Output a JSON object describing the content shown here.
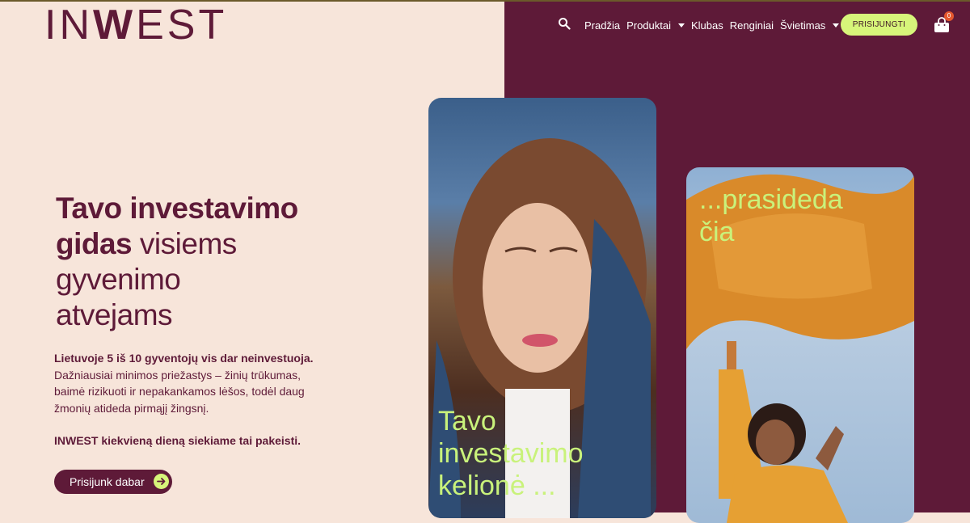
{
  "brand": {
    "logo": "INWEST",
    "logo_left": "IN",
    "logo_w": "W",
    "logo_right": "EST"
  },
  "nav": {
    "items": [
      {
        "label": "Pradžia",
        "dropdown": false
      },
      {
        "label": "Produktai",
        "dropdown": true
      },
      {
        "label": "Klubas",
        "dropdown": false
      },
      {
        "label": "Renginiai",
        "dropdown": false
      },
      {
        "label": "Švietimas",
        "dropdown": true
      }
    ],
    "login_label": "PRISIJUNGTI",
    "cart_count": "0"
  },
  "hero": {
    "headline_bold_1": "Tavo investavimo",
    "headline_bold_2": "gidas",
    "headline_rest_1": " visiems",
    "headline_rest_2": "gyvenimo",
    "headline_rest_3": "atvejams",
    "intro_bold": "Lietuvoje 5 iš 10 gyventojų vis dar neinvestuoja.",
    "intro_text": "Dažniausiai minimos priežastys – žinių trūkumas, baimė rizikuoti ir nepakankamos lėšos, todėl daug žmonių atideda pirmąjį žingsnį.",
    "outro_bold": "INWEST kiekvieną dieną siekiame tai pakeisti.",
    "cta_label": "Prisijunk dabar"
  },
  "cards": [
    {
      "text": "Tavo investavimo kelionė ..."
    },
    {
      "text": "...prasideda čia"
    }
  ],
  "colors": {
    "primary": "#5e1a38",
    "accent": "#d7f57a",
    "bg": "#f7e5da",
    "card_text": "#c9f27b"
  }
}
